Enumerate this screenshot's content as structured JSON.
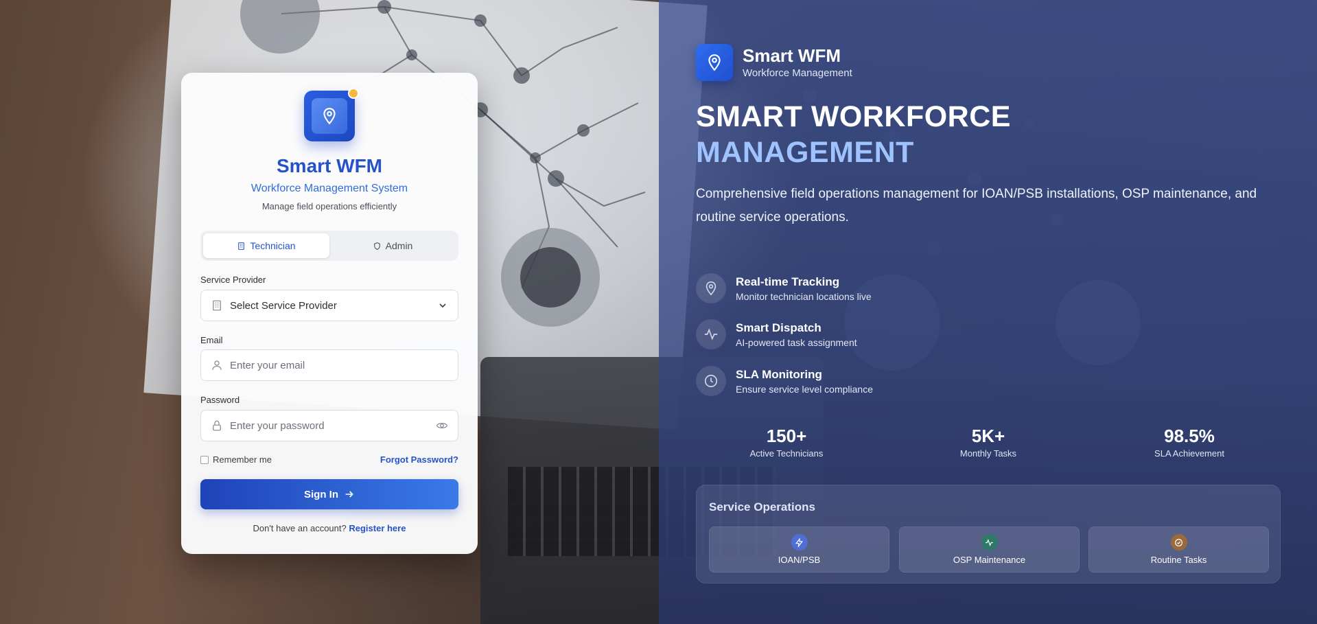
{
  "login": {
    "app_name": "Smart WFM",
    "app_subtitle": "Workforce Management System",
    "app_description": "Manage field operations efficiently",
    "tabs": [
      {
        "label": "Technician",
        "icon": "building-icon",
        "active": true
      },
      {
        "label": "Admin",
        "icon": "shield-icon",
        "active": false
      }
    ],
    "service_provider": {
      "label": "Service Provider",
      "placeholder": "Select Service Provider"
    },
    "email": {
      "label": "Email",
      "placeholder": "Enter your email",
      "value": ""
    },
    "password": {
      "label": "Password",
      "placeholder": "Enter your password",
      "value": ""
    },
    "remember_label": "Remember me",
    "forgot_label": "Forgot Password?",
    "signin_label": "Sign In",
    "register_prompt": "Don't have an account?",
    "register_link": "Register here"
  },
  "brand": {
    "name": "Smart WFM",
    "subtitle": "Workforce Management"
  },
  "hero": {
    "line1": "SMART WORKFORCE",
    "line2": "MANAGEMENT",
    "description": "Comprehensive field operations management for IOAN/PSB installations, OSP maintenance, and routine service operations."
  },
  "features": [
    {
      "title": "Real-time Tracking",
      "desc": "Monitor technician locations live",
      "icon": "map-pin-icon"
    },
    {
      "title": "Smart Dispatch",
      "desc": "AI-powered task assignment",
      "icon": "activity-icon"
    },
    {
      "title": "SLA Monitoring",
      "desc": "Ensure service level compliance",
      "icon": "clock-icon"
    }
  ],
  "stats": [
    {
      "value": "150+",
      "label": "Active Technicians"
    },
    {
      "value": "5K+",
      "label": "Monthly Tasks"
    },
    {
      "value": "98.5%",
      "label": "SLA Achievement"
    }
  ],
  "operations": {
    "title": "Service Operations",
    "items": [
      {
        "label": "IOAN/PSB",
        "icon": "lightning-icon",
        "color": "#4f6fd6"
      },
      {
        "label": "OSP Maintenance",
        "icon": "activity-icon",
        "color": "#2f7a66"
      },
      {
        "label": "Routine Tasks",
        "icon": "check-circle-icon",
        "color": "#9a6a3a"
      }
    ]
  },
  "colors": {
    "primary": "#2553c7",
    "accent": "#9fc3ff",
    "gradient_start": "#1f43b8",
    "gradient_end": "#3a7ae8"
  }
}
